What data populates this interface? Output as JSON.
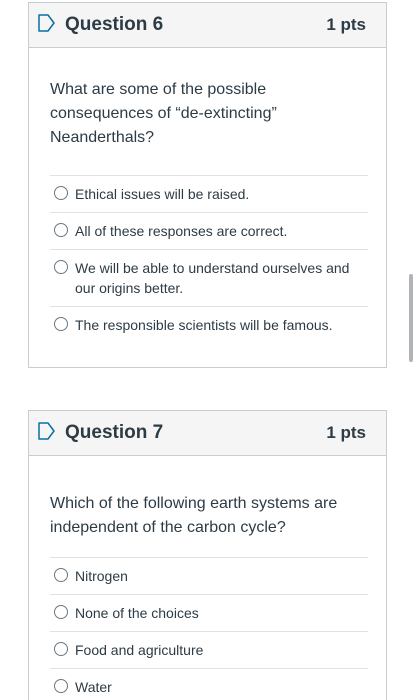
{
  "questions": [
    {
      "title": "Question 6",
      "points": "1 pts",
      "text": "What are some of the possible consequences of “de-extincting” Neanderthals?",
      "answers": [
        "Ethical issues will be raised.",
        "All of these responses are correct.",
        "We will be able to understand ourselves and our origins better.",
        "The responsible scientists will be famous."
      ]
    },
    {
      "title": "Question 7",
      "points": "1 pts",
      "text": "Which of the following earth systems are independent of the carbon cycle?",
      "answers": [
        "Nitrogen",
        "None of the choices",
        "Food and agriculture",
        "Water"
      ]
    }
  ],
  "icons": {
    "bookmark": "bookmark-icon",
    "radio": "radio-button-icon"
  },
  "colors": {
    "bookmark_accent": "#0770a3",
    "text": "#2d3b45",
    "border": "#c7cdd1",
    "header_bg": "#f5f5f5"
  }
}
